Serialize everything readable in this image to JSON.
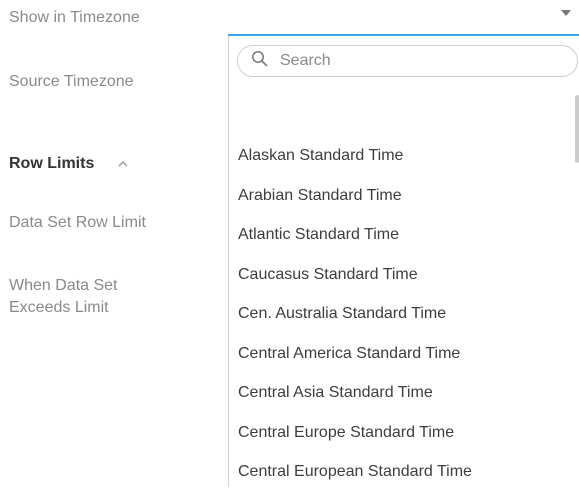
{
  "labels": {
    "show_in_timezone": "Show in Timezone",
    "source_timezone": "Source Timezone",
    "row_limits": "Row Limits",
    "data_set_row_limit": "Data Set Row Limit",
    "when_exceeds_line1": "When Data Set",
    "when_exceeds_line2": "Exceeds Limit"
  },
  "icons": {
    "row_limits_toggle": "chevron-up-icon",
    "dropdown_arrow": "caret-down-icon",
    "search": "search-icon"
  },
  "colors": {
    "accent": "#3ba3e8",
    "label": "#8a8a8a",
    "heading": "#333333",
    "item_text": "#3d3d3d"
  },
  "search": {
    "placeholder": "Search",
    "value": ""
  },
  "timezones": [
    "Alaskan Standard Time",
    "Arabian Standard Time",
    "Atlantic Standard Time",
    "Caucasus Standard Time",
    "Cen. Australia Standard Time",
    "Central America Standard Time",
    "Central Asia Standard Time",
    "Central Europe Standard Time",
    "Central European Standard Time"
  ]
}
